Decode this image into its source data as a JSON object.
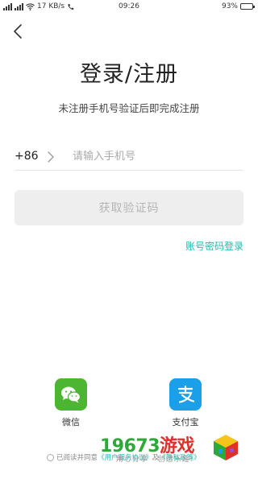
{
  "status_bar": {
    "network_speed": "17 KB/s",
    "time": "09:26",
    "battery": "93%",
    "battery_level": 0.93
  },
  "header": {
    "title": "登录/注册",
    "subtitle": "未注册手机号验证后即完成注册"
  },
  "phone": {
    "country_code": "+86",
    "placeholder": "请输入手机号",
    "value": ""
  },
  "actions": {
    "get_code_label": "获取验证码",
    "password_login_label": "账号密码登录"
  },
  "third_party": {
    "wechat_label": "微信",
    "alipay_label": "支付宝"
  },
  "agreement": {
    "prefix": "已阅读并同意",
    "user_agreement": "《用户服务协议》",
    "conjunction": "及",
    "privacy_policy": "《隐私政策》"
  },
  "watermark": {
    "number": "19673",
    "word": "游戏",
    "slogan": "用心分享 · 创造乐趣!"
  },
  "colors": {
    "accent": "#25b8b0",
    "wechat": "#4cb531",
    "alipay": "#1b9fe8",
    "button_disabled_bg": "#eeeeee",
    "button_disabled_text": "#b5b5b5"
  },
  "icons": [
    "signal-icon",
    "wifi-icon",
    "call-icon",
    "battery-icon",
    "back-icon",
    "chevron-right-icon",
    "wechat-icon",
    "alipay-icon",
    "radio-icon"
  ]
}
